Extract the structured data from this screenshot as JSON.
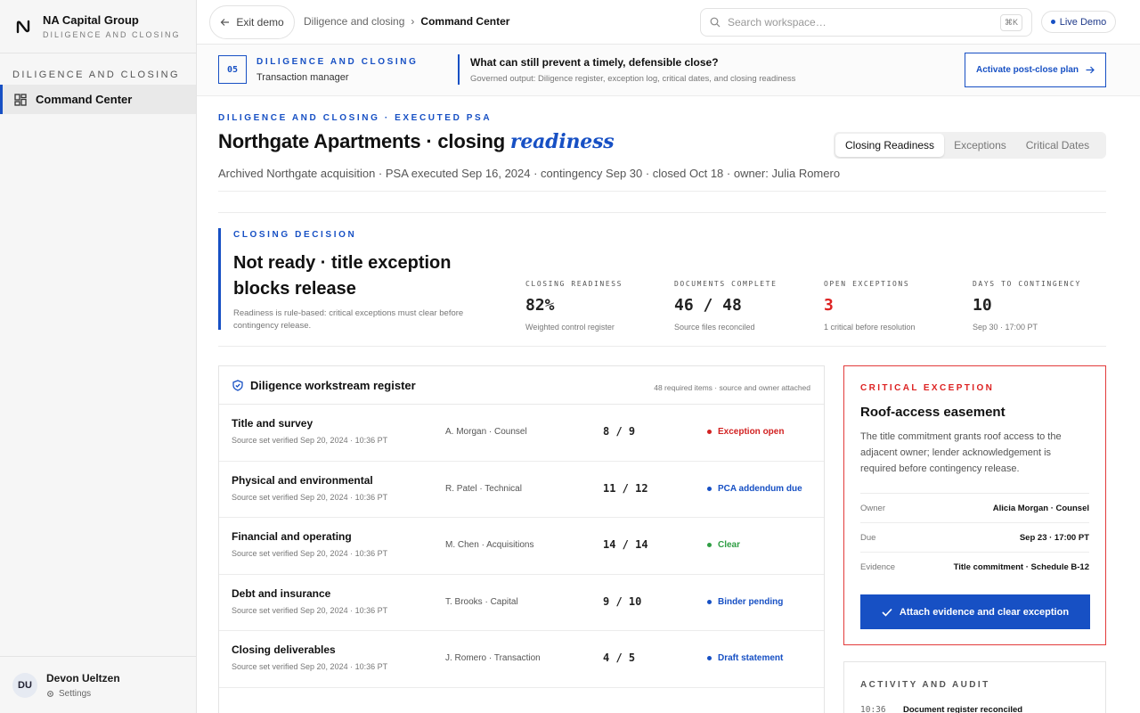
{
  "brand": {
    "name": "NA Capital Group",
    "sub": "DILIGENCE AND CLOSING"
  },
  "sidebar": {
    "section": "DILIGENCE AND CLOSING",
    "items": [
      {
        "label": "Command Center",
        "icon": "dashboard-grid-icon",
        "active": true
      }
    ]
  },
  "user": {
    "initials": "DU",
    "name": "Devon Ueltzen",
    "settings": "Settings"
  },
  "topbar": {
    "exit": "Exit demo",
    "breadcrumb": [
      "Diligence and closing",
      "Command Center"
    ],
    "search_placeholder": "Search workspace…",
    "shortcut": "⌘K",
    "live": "Live Demo"
  },
  "stage": {
    "step": "05",
    "title": "DILIGENCE AND CLOSING",
    "role": "Transaction manager",
    "question": "What can still prevent a timely, defensible close?",
    "governed": "Governed output: Diligence register, exception log, critical dates, and closing readiness",
    "action": "Activate post-close plan"
  },
  "page": {
    "eyebrow": "DILIGENCE AND CLOSING · EXECUTED PSA",
    "title_main": "Northgate Apartments · closing",
    "title_accent": "readiness",
    "meta": "Archived Northgate acquisition · PSA executed Sep 16, 2024 · contingency Sep 30 · closed Oct 18 · owner: Julia Romero",
    "tabs": [
      "Closing Readiness",
      "Exceptions",
      "Critical Dates"
    ]
  },
  "decision": {
    "eyebrow": "CLOSING DECISION",
    "title": "Not ready · title exception blocks release",
    "note": "Readiness is rule-based: critical exceptions must clear before contingency release."
  },
  "kpis": [
    {
      "label": "CLOSING READINESS",
      "value": "82%",
      "sub": "Weighted control register",
      "alert": false
    },
    {
      "label": "DOCUMENTS COMPLETE",
      "value": "46 / 48",
      "sub": "Source files reconciled",
      "alert": false
    },
    {
      "label": "OPEN EXCEPTIONS",
      "value": "3",
      "sub": "1 critical before resolution",
      "alert": true
    },
    {
      "label": "DAYS TO CONTINGENCY",
      "value": "10",
      "sub": "Sep 30 · 17:00 PT",
      "alert": false
    }
  ],
  "register": {
    "title": "Diligence workstream register",
    "note": "48 required items · source and owner attached",
    "rows": [
      {
        "name": "Title and survey",
        "source": "Source set verified Sep 20, 2024 · 10:36 PT",
        "owner": "A. Morgan · Counsel",
        "count": "8 / 9",
        "status": "Exception open",
        "status_color": "#d22222"
      },
      {
        "name": "Physical and environmental",
        "source": "Source set verified Sep 20, 2024 · 10:36 PT",
        "owner": "R. Patel · Technical",
        "count": "11 / 12",
        "status": "PCA addendum due",
        "status_color": "#1750c4"
      },
      {
        "name": "Financial and operating",
        "source": "Source set verified Sep 20, 2024 · 10:36 PT",
        "owner": "M. Chen · Acquisitions",
        "count": "14 / 14",
        "status": "Clear",
        "status_color": "#2f9e44"
      },
      {
        "name": "Debt and insurance",
        "source": "Source set verified Sep 20, 2024 · 10:36 PT",
        "owner": "T. Brooks · Capital",
        "count": "9 / 10",
        "status": "Binder pending",
        "status_color": "#1750c4"
      },
      {
        "name": "Closing deliverables",
        "source": "Source set verified Sep 20, 2024 · 10:36 PT",
        "owner": "J. Romero · Transaction",
        "count": "4 / 5",
        "status": "Draft statement",
        "status_color": "#1750c4"
      }
    ]
  },
  "critical": {
    "eyebrow": "CRITICAL EXCEPTION",
    "title": "Roof-access easement",
    "desc": "The title commitment grants roof access to the adjacent owner; lender acknowledgement is required before contingency release.",
    "rows": [
      {
        "k": "Owner",
        "v": "Alicia Morgan · Counsel"
      },
      {
        "k": "Due",
        "v": "Sep 23 · 17:00 PT"
      },
      {
        "k": "Evidence",
        "v": "Title commitment · Schedule B-12"
      }
    ],
    "action": "Attach evidence and clear exception"
  },
  "activity": {
    "eyebrow": "ACTIVITY AND AUDIT",
    "rows": [
      {
        "time": "10:36",
        "text": "Document register reconciled"
      }
    ]
  }
}
